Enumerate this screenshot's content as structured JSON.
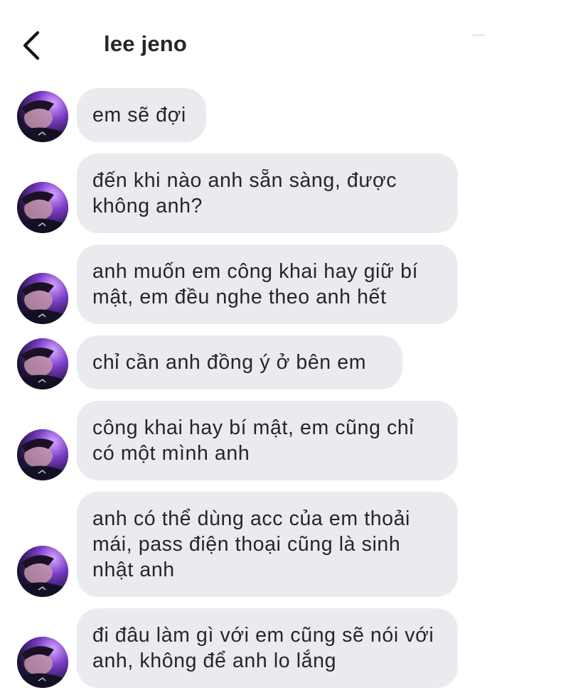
{
  "header": {
    "title": "lee jeno",
    "back_icon": "chevron-left-icon"
  },
  "messages": [
    {
      "text": "em sẽ đợi"
    },
    {
      "text": "đến khi nào anh sẵn sàng, được không anh?"
    },
    {
      "text": "anh muốn em công khai hay giữ bí mật, em đều nghe theo anh hết"
    },
    {
      "text": "chỉ cần anh đồng ý ở bên em"
    },
    {
      "text": "công khai hay bí mật, em cũng chỉ có một mình anh"
    },
    {
      "text": "anh có thể dùng acc của em thoải mái, pass điện thoại cũng là sinh nhật anh"
    },
    {
      "text": "đi đâu làm gì với em cũng sẽ nói với anh, không để anh lo lắng"
    }
  ],
  "colors": {
    "bubble": "#e9ebee",
    "text": "#262626",
    "background": "#ffffff"
  }
}
